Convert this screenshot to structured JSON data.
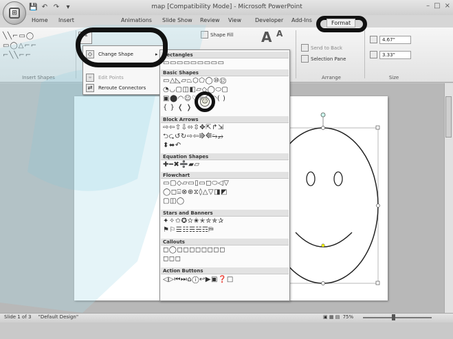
{
  "window": {
    "title": "map [Compatibility Mode] - Microsoft PowerPoint",
    "office_button_glyph": "⊞",
    "controls": [
      "–",
      "□",
      "×"
    ]
  },
  "quick_access": [
    "💾",
    "↶",
    "↷",
    "▾"
  ],
  "tabs": [
    "Home",
    "Insert",
    "Animations",
    "Slide Show",
    "Review",
    "View",
    "Developer",
    "Add-Ins",
    "Format"
  ],
  "ribbon": {
    "insert_shapes_label": "Insert Shapes",
    "shape_rows": [
      "╲╲⌐▭◯",
      "▭◯△⌐⌐",
      "⌐╲╲⌐⌐"
    ],
    "shape_fill": "Shape Fill",
    "send_to_back": "Send to Back",
    "selection_pane": "Selection Pane",
    "arrange_label": "Arrange",
    "size_label": "Size",
    "height": "4.67\"",
    "width": "3.33\"",
    "text_a": "A"
  },
  "edit_menu": {
    "change_shape": "Change Shape",
    "edit_points": "Edit Points",
    "reroute": "Reroute Connectors"
  },
  "gallery": {
    "categories": [
      {
        "title": "Rectangles",
        "rows": [
          "▭▭▭▭▭▭▭▭▭"
        ]
      },
      {
        "title": "Basic Shapes",
        "rows": [
          "▭△◺▱⏢⬡⬠◯⑩⑫",
          "◔◡▢◫◧▱◇◯⬭▢",
          "▣⬤◠☺♡☼☾◜◝( )",
          "{ } ❬ ❭"
        ]
      },
      {
        "title": "Block Arrows",
        "rows": [
          "⇨⇦⇧⇩⬄⇳✥⇱↱⇲",
          "⮌⮎↺↻⇨⇦⭆⭅⭇⭈",
          "⬍⬌↶"
        ]
      },
      {
        "title": "Equation Shapes",
        "rows": [
          "✚━✖➗▰▱"
        ]
      },
      {
        "title": "Flowchart",
        "rows": [
          "▭▢◇▱▭▯▭◻⬭◁▽",
          "◯◻⌺⊗⊕⧖◊△▽◨◩",
          "▢◫◯"
        ]
      },
      {
        "title": "Stars and Banners",
        "rows": [
          "✦✧✩✪✫✬✭✮✯✰",
          "⚑⚐☰☷☴☵☶⛿"
        ]
      },
      {
        "title": "Callouts",
        "rows": [
          "◻◯◻◻◻◻◻◻◻◻",
          "◻◻◻"
        ]
      },
      {
        "title": "Action Buttons",
        "rows": [
          "◁▷⏮⏭⌂ⓘ↩▶▣❓□"
        ]
      }
    ]
  },
  "status": {
    "slide": "Slide 1 of 3",
    "design": "\"Default Design\"",
    "zoom": "75%"
  }
}
